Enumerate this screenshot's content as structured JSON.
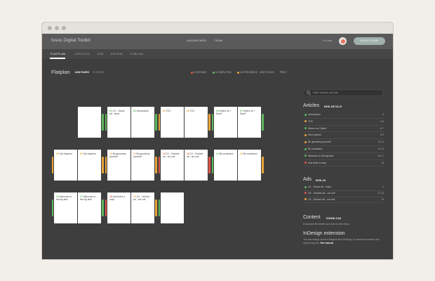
{
  "app": {
    "title": "Issuu Digital Toolkit",
    "top_nav": [
      "DASHBOARD",
      "TEAM"
    ],
    "user_name": "Hi Kasia",
    "home_button": "ISSUU HOME"
  },
  "sub_nav": [
    "FLATPLAN",
    "ARTICLES",
    "ADS",
    "REVIEW",
    "PUBLISH"
  ],
  "flatplan": {
    "title": "Flatplan",
    "add_pages": "ADD PAGES",
    "pages_count": "20 PAGES",
    "legend": [
      {
        "label": "6 OVERDUE",
        "color": "#e0564a"
      },
      {
        "label": "8 COMPLETED",
        "color": "#5cb85c"
      },
      {
        "label": "6 IN PROGRESS",
        "color": "#e8a33a"
      },
      {
        "label": "HIDE STATUS",
        "color": ""
      },
      {
        "label": "PRINT",
        "color": ""
      }
    ],
    "rows": [
      [
        {
          "pages": [
            {
              "num": "",
              "text": ""
            }
          ],
          "left": "",
          "right": "#5cb85c",
          "single": true
        },
        {
          "pages": [
            {
              "num": "02",
              "text": "2/1 - House ad - Issuu"
            },
            {
              "num": "03",
              "text": "Introduction"
            }
          ],
          "left": "#5cb85c",
          "right": "#5cb85c"
        },
        {
          "pages": [
            {
              "num": "04",
              "text": "TOC"
            },
            {
              "num": "05",
              "text": "TOC"
            }
          ],
          "left": "#e8a33a",
          "right": "#e8a33a"
        },
        {
          "pages": [
            {
              "num": "06",
              "text": "Where do I Start?"
            },
            {
              "num": "07",
              "text": "Where do I Start?"
            }
          ],
          "left": "#5cb85c",
          "right": "#5cb85c"
        }
      ],
      [
        {
          "pages": [
            {
              "num": "08",
              "text": "Get Inspired"
            },
            {
              "num": "09",
              "text": "Get Inspired"
            }
          ],
          "left": "#e8a33a",
          "right": "#e8a33a"
        },
        {
          "pages": [
            {
              "num": "10",
              "text": "Be genuinely yourself"
            },
            {
              "num": "11",
              "text": "Be genuinely yourself"
            }
          ],
          "left": "#e8a33a",
          "right": "#e8a33a"
        },
        {
          "pages": [
            {
              "num": "12",
              "text": "2/1 - Panther ad - out unit"
            },
            {
              "num": "13",
              "text": "2/1 - Panther ad - out unit"
            }
          ],
          "left": "#e0564a",
          "right": "#e0564a"
        },
        {
          "pages": [
            {
              "num": "14",
              "text": "Be consistent"
            },
            {
              "num": "15",
              "text": "Be consistent"
            }
          ],
          "left": "#5cb85c",
          "right": "#e8a33a"
        }
      ],
      [
        {
          "pages": [
            {
              "num": "16",
              "text": "Welcome to the big time"
            },
            {
              "num": "17",
              "text": "Welcome to the big time"
            }
          ],
          "left": "#5cb85c",
          "right": "#5cb85c"
        },
        {
          "pages": [
            {
              "num": "18",
              "text": "And that's a wrap"
            },
            {
              "num": "19",
              "text": "2/1 - Unicorn ad - out unit"
            }
          ],
          "left": "#e0564a",
          "right": "#e8a33a"
        },
        {
          "pages": [
            {
              "num": "",
              "text": ""
            }
          ],
          "left": "#5cb85c",
          "right": "",
          "single": true
        }
      ]
    ]
  },
  "search": {
    "placeholder": "Filter articles and ads"
  },
  "articles": {
    "title": "Articles",
    "button": "NEW ARTICLE",
    "items": [
      {
        "label": "Introduction",
        "pages": "3",
        "color": "#5cb85c"
      },
      {
        "label": "TOC",
        "pages": "4-5",
        "color": "#e8a33a"
      },
      {
        "label": "Where do I Start?",
        "pages": "6-7",
        "color": "#5cb85c"
      },
      {
        "label": "Get Inspired",
        "pages": "8-9",
        "color": "#e8a33a"
      },
      {
        "label": "Be genuinely yourself",
        "pages": "10-11",
        "color": "#e8a33a"
      },
      {
        "label": "Be consistent",
        "pages": "14-15",
        "color": "#5cb85c"
      },
      {
        "label": "Welcome to the big time",
        "pages": "16-17",
        "color": "#5cb85c"
      },
      {
        "label": "And that's a wrap",
        "pages": "18",
        "color": "#e0564a"
      }
    ]
  },
  "ads": {
    "title": "Ads",
    "button": "NEW AD",
    "items": [
      {
        "label": "1/1 - House ad - issuu",
        "pages": "2",
        "color": "#5cb85c"
      },
      {
        "label": "2/1 - Panther ad - out unit",
        "pages": "12-13",
        "color": "#e0564a"
      },
      {
        "label": "1/1 - Unicorn ad - out unit",
        "pages": "19",
        "color": "#e8a33a"
      }
    ]
  },
  "content": {
    "title": "Content",
    "button": "DOWNLOAD",
    "description": "Download all articles and ads for this issue."
  },
  "indesign": {
    "title": "InDesign extension",
    "description": "You can easily connect Magma and InDesign to download content and upload layouts.",
    "link": "See how-to"
  }
}
